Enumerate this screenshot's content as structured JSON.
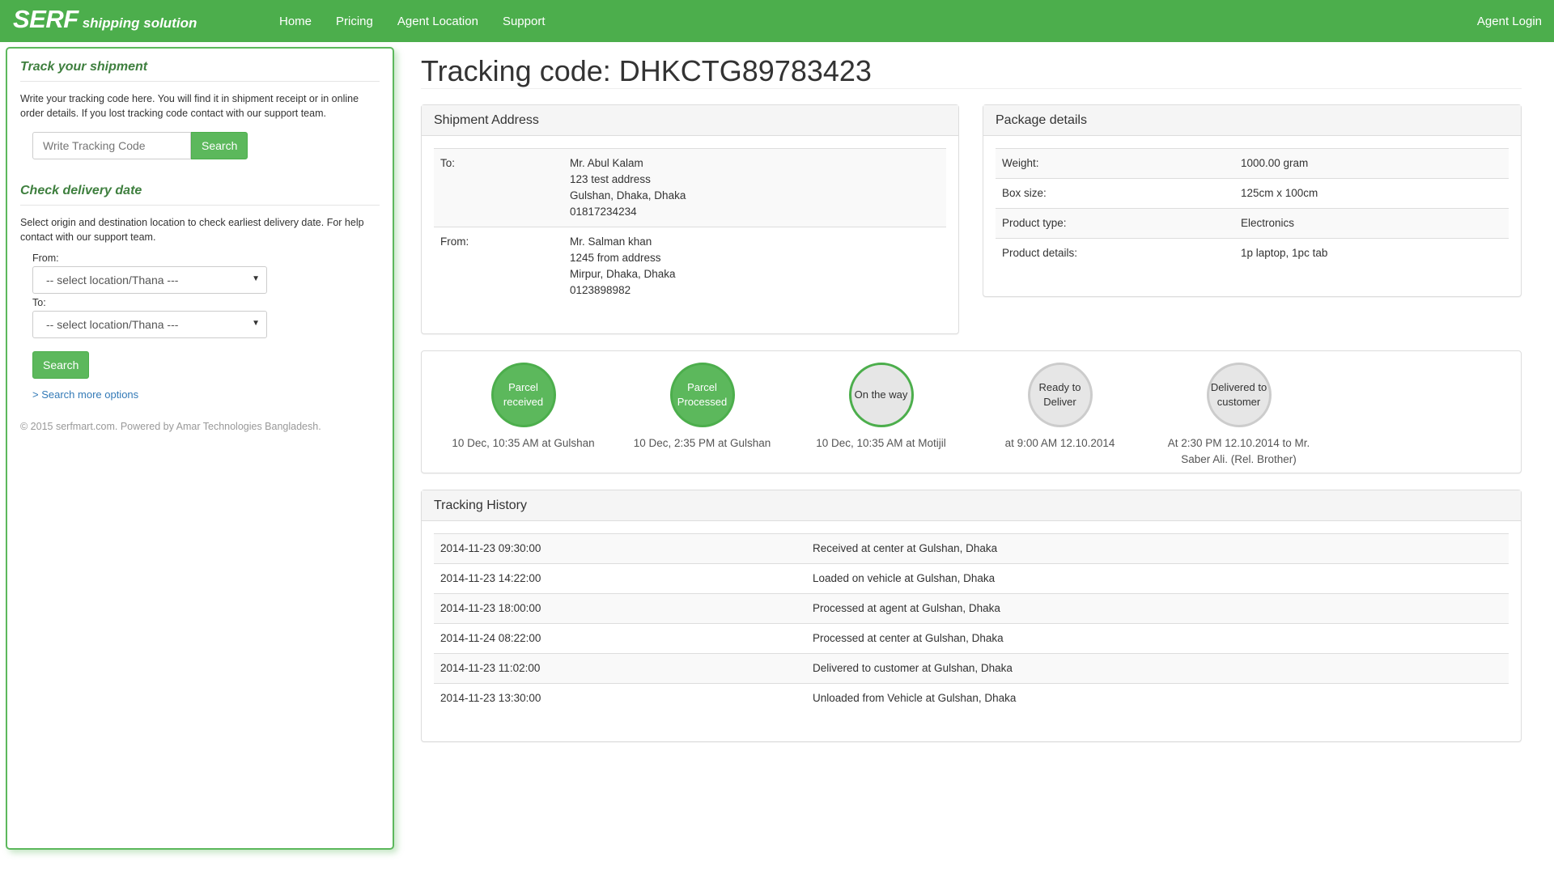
{
  "brand": {
    "main": "SERF",
    "sub": "shipping solution"
  },
  "nav": {
    "items": [
      "Home",
      "Pricing",
      "Agent Location",
      "Support"
    ],
    "login": "Agent Login"
  },
  "sidebar": {
    "track": {
      "heading": "Track your shipment",
      "description": "Write your tracking code here. You will find it in shipment receipt or in online order details. If you lost tracking code contact with our support team.",
      "placeholder": "Write Tracking Code",
      "button": "Search"
    },
    "delivery": {
      "heading": "Check delivery date",
      "description": "Select origin and destination location to check earliest delivery date. For help contact with our support team.",
      "from_label": "From:",
      "to_label": "To:",
      "from_value": "-- select location/Thana ---",
      "to_value": "-- select location/Thana ---",
      "button": "Search",
      "more": "> Search more options"
    },
    "copyright": "© 2015 serfmart.com. Powered by Amar Technologies Bangladesh."
  },
  "main": {
    "title": "Tracking code: DHKCTG89783423",
    "shipment": {
      "heading": "Shipment Address",
      "to_label": "To:",
      "to_lines": [
        "Mr. Abul Kalam",
        "123 test address",
        "Gulshan, Dhaka, Dhaka",
        "01817234234"
      ],
      "from_label": "From:",
      "from_lines": [
        "Mr. Salman khan",
        "1245 from address",
        "Mirpur, Dhaka, Dhaka",
        "0123898982"
      ]
    },
    "package": {
      "heading": "Package details",
      "rows": [
        {
          "label": "Weight:",
          "value": "1000.00 gram"
        },
        {
          "label": "Box size:",
          "value": "125cm x 100cm"
        },
        {
          "label": "Product type:",
          "value": "Electronics"
        },
        {
          "label": "Product details:",
          "value": "1p laptop, 1pc tab"
        }
      ]
    },
    "steps": [
      {
        "label_line1": "Parcel",
        "label_line2": "received",
        "text": "10 Dec, 10:35 AM at Gulshan",
        "state": "done"
      },
      {
        "label_line1": "Parcel",
        "label_line2": "Processed",
        "text": "10 Dec, 2:35 PM at Gulshan",
        "state": "done"
      },
      {
        "label_line1": "On the way",
        "label_line2": "",
        "text": "10 Dec, 10:35 AM at Motijil",
        "state": "current"
      },
      {
        "label_line1": "Ready to",
        "label_line2": "Deliver",
        "text": "at 9:00 AM 12.10.2014",
        "state": "todo"
      },
      {
        "label_line1": "Delivered to",
        "label_line2": "customer",
        "text": "At 2:30 PM 12.10.2014 to Mr. Saber Ali. (Rel. Brother)",
        "state": "todo"
      }
    ],
    "history": {
      "heading": "Tracking History",
      "rows": [
        {
          "time": "2014-11-23 09:30:00",
          "event": "Received at center at Gulshan, Dhaka"
        },
        {
          "time": "2014-11-23 14:22:00",
          "event": "Loaded on vehicle at Gulshan, Dhaka"
        },
        {
          "time": "2014-11-23 18:00:00",
          "event": "Processed at agent at Gulshan, Dhaka"
        },
        {
          "time": "2014-11-24 08:22:00",
          "event": "Processed at center at Gulshan, Dhaka"
        },
        {
          "time": "2014-11-23 11:02:00",
          "event": "Delivered to customer at Gulshan, Dhaka"
        },
        {
          "time": "2014-11-23 13:30:00",
          "event": "Unloaded from Vehicle at Gulshan, Dhaka"
        }
      ]
    }
  },
  "colors": {
    "brand_green": "#4cae4c",
    "button_green": "#5cb85c",
    "link_blue": "#337ab7",
    "heading_green": "#3e7f3e"
  }
}
